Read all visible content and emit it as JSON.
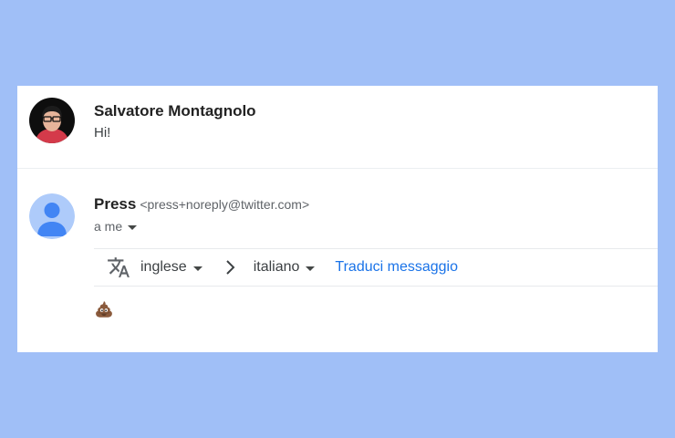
{
  "message1": {
    "sender_name": "Salvatore Montagnolo",
    "snippet": "Hi!"
  },
  "message2": {
    "sender_name": "Press",
    "sender_email": "<press+noreply@twitter.com>",
    "recipient": "a me"
  },
  "translation": {
    "icon": "translate-icon",
    "source_language": "inglese",
    "target_language": "italiano",
    "action_label": "Traduci messaggio"
  },
  "body": {
    "content_icon": "pile-of-poo-emoji"
  },
  "colors": {
    "background": "#a0bff7",
    "card": "#ffffff",
    "link": "#1a73e8",
    "default_avatar_bg": "#aecbfa",
    "default_avatar_fg": "#4285f4"
  }
}
